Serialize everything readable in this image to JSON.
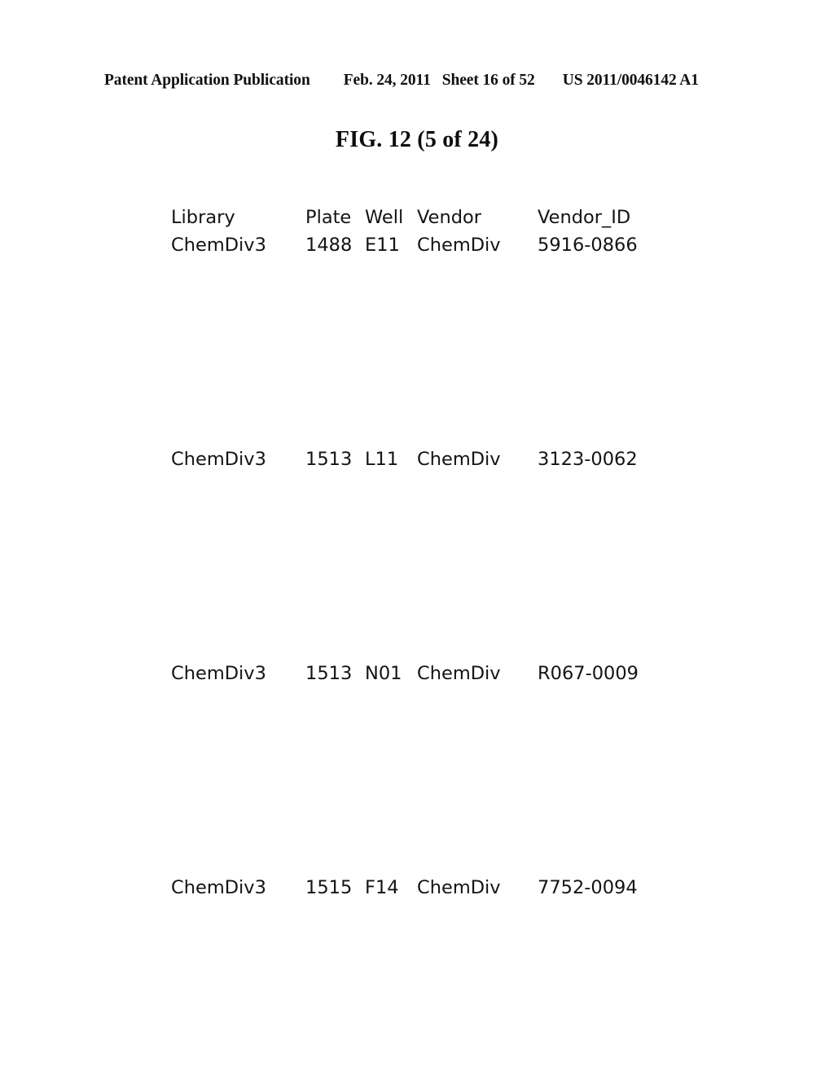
{
  "header": {
    "publication": "Patent Application Publication",
    "date": "Feb. 24, 2011",
    "sheet": "Sheet 16 of 52",
    "patent_number": "US 2011/0046142 A1"
  },
  "figure": {
    "title": "FIG. 12 (5 of 24)"
  },
  "table": {
    "columns": [
      {
        "key": "library",
        "label": "Library"
      },
      {
        "key": "plate",
        "label": "Plate"
      },
      {
        "key": "well",
        "label": "Well"
      },
      {
        "key": "vendor",
        "label": "Vendor"
      },
      {
        "key": "vendor_id",
        "label": "Vendor_ID"
      }
    ],
    "rows": [
      {
        "library": "ChemDiv3",
        "plate": "1488",
        "well": "E11",
        "vendor": "ChemDiv",
        "vendor_id": "5916-0866"
      },
      {
        "library": "ChemDiv3",
        "plate": "1513",
        "well": "L11",
        "vendor": "ChemDiv",
        "vendor_id": "3123-0062"
      },
      {
        "library": "ChemDiv3",
        "plate": "1513",
        "well": "N01",
        "vendor": "ChemDiv",
        "vendor_id": "R067-0009"
      },
      {
        "library": "ChemDiv3",
        "plate": "1515",
        "well": "F14",
        "vendor": "ChemDiv",
        "vendor_id": "7752-0094"
      }
    ]
  },
  "colors": {
    "page_background": "#ffffff",
    "text": "#141414",
    "header_text": "#111111"
  }
}
